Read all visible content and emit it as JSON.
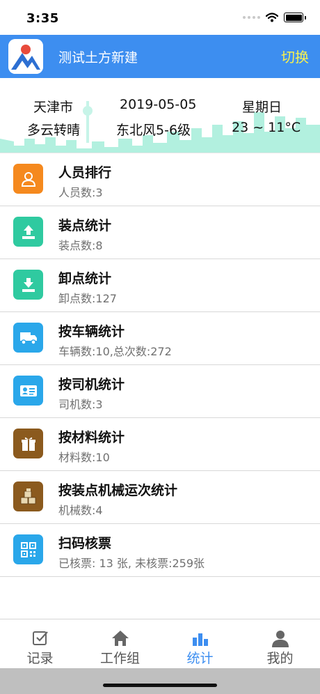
{
  "status": {
    "time": "3:35"
  },
  "header": {
    "title": "测试土方新建",
    "switch_label": "切换"
  },
  "weather": {
    "city": "天津市",
    "date": "2019-05-05",
    "weekday": "星期日",
    "condition": "多云转晴",
    "wind": "东北风5-6级",
    "temp": "23 ~ 11°C"
  },
  "items": [
    {
      "title": "人员排行",
      "sub": "人员数:3",
      "icon": "person-icon",
      "color": "#f5891e"
    },
    {
      "title": "装点统计",
      "sub": "装点数:8",
      "icon": "upload-icon",
      "color": "#2fcaa0"
    },
    {
      "title": "卸点统计",
      "sub": "卸点数:127",
      "icon": "download-icon",
      "color": "#2fcaa0"
    },
    {
      "title": "按车辆统计",
      "sub": "车辆数:10,总次数:272",
      "icon": "truck-icon",
      "color": "#2aa7ea"
    },
    {
      "title": "按司机统计",
      "sub": "司机数:3",
      "icon": "id-card-icon",
      "color": "#2aa7ea"
    },
    {
      "title": "按材料统计",
      "sub": "材料数:10",
      "icon": "gift-box-icon",
      "color": "#8b5a1e"
    },
    {
      "title": "按装点机械运次统计",
      "sub": "机械数:4",
      "icon": "crates-icon",
      "color": "#8b5a1e"
    },
    {
      "title": "扫码核票",
      "sub": "已核票: 13 张, 未核票:259张",
      "icon": "qr-code-icon",
      "color": "#2aa7ea"
    }
  ],
  "tabs": [
    {
      "label": "记录",
      "icon": "checkbox-icon",
      "active": false
    },
    {
      "label": "工作组",
      "icon": "home-icon",
      "active": false
    },
    {
      "label": "统计",
      "icon": "bar-chart-icon",
      "active": true
    },
    {
      "label": "我的",
      "icon": "user-icon",
      "active": false
    }
  ],
  "colors": {
    "primary": "#3d8ef0",
    "switch": "#f7f050",
    "skyline": "#b2f0df"
  }
}
